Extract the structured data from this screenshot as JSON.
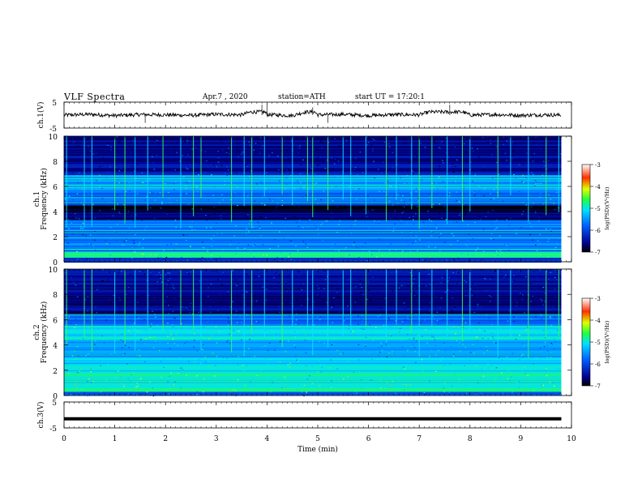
{
  "header": {
    "title": "VLF Spectra",
    "date": "Apr.7 , 2020",
    "station": "station=ATH",
    "start": "start UT = 17:20:1"
  },
  "chart_data": [
    {
      "type": "line",
      "panel": "ch1-waveform",
      "ylabel": "ch.1(V)",
      "ylim": [
        -5,
        5
      ],
      "yticks": [
        "5",
        "-5"
      ],
      "xlim": [
        0,
        10
      ],
      "series": [
        {
          "color": "#000000",
          "x": [
            0,
            0.5,
            1,
            1.5,
            2,
            2.5,
            3,
            3.5,
            3.9,
            4,
            4.5,
            4.9,
            5,
            5.5,
            6,
            6.5,
            7,
            7.6,
            8,
            8.5,
            9,
            9.5,
            9.8
          ],
          "values": [
            0,
            0.3,
            -0.2,
            0.2,
            0.1,
            -0.1,
            0.3,
            0.1,
            2.5,
            0.2,
            -0.2,
            2.0,
            0.1,
            0.3,
            -0.2,
            0.2,
            0.1,
            3.5,
            0,
            0.2,
            -0.1,
            0.1,
            0
          ]
        }
      ],
      "spikes": [
        {
          "x": 1.6,
          "values": [
            -3
          ]
        },
        {
          "x": 3.9,
          "values": [
            4
          ]
        },
        {
          "x": 4.0,
          "values": [
            4
          ]
        },
        {
          "x": 4.9,
          "values": [
            3
          ]
        },
        {
          "x": 5.2,
          "values": [
            -3
          ]
        },
        {
          "x": 7.6,
          "values": [
            4
          ]
        }
      ]
    },
    {
      "type": "heatmap",
      "panel": "ch1-spectrogram",
      "ylabel": [
        "ch.1",
        "Frequency (kHz)"
      ],
      "ylim": [
        0,
        10
      ],
      "yticks": [
        "0",
        "2",
        "4",
        "6",
        "8",
        "10"
      ],
      "xlim": [
        0,
        9.8
      ],
      "colorbar": {
        "label": "log(PSD)(V²/Hz)",
        "range": [
          -7,
          -3
        ],
        "ticks": [
          "-3",
          "-4",
          "-5",
          "-6",
          "-7"
        ],
        "colormap": "jet"
      },
      "frequency_bands": [
        {
          "f": [
            0.0,
            0.4
          ],
          "level": -6.3
        },
        {
          "f": [
            0.4,
            0.9
          ],
          "level": -4.8
        },
        {
          "f": [
            0.9,
            1.5
          ],
          "level": -5.6
        },
        {
          "f": [
            1.5,
            2.6
          ],
          "level": -5.9
        },
        {
          "f": [
            2.6,
            3.4
          ],
          "level": -5.6
        },
        {
          "f": [
            3.4,
            4.0
          ],
          "level": -6.6
        },
        {
          "f": [
            4.0,
            4.5
          ],
          "level": -6.8
        },
        {
          "f": [
            4.5,
            5.5
          ],
          "level": -5.8
        },
        {
          "f": [
            5.5,
            7.0
          ],
          "level": -5.5
        },
        {
          "f": [
            7.0,
            8.5
          ],
          "level": -6.5
        },
        {
          "f": [
            8.5,
            10.0
          ],
          "level": -6.6
        }
      ],
      "tones_khz": [
        0.45,
        0.7,
        1.0,
        1.9,
        2.3,
        2.5,
        4.7,
        5.1,
        5.9,
        6.1,
        6.6,
        6.8
      ],
      "sferics_min": [
        0.05,
        0.4,
        0.55,
        1.0,
        1.2,
        1.4,
        1.65,
        1.95,
        2.3,
        2.55,
        2.7,
        3.3,
        3.55,
        3.7,
        3.95,
        4.3,
        4.5,
        4.8,
        4.9,
        5.2,
        5.5,
        5.65,
        5.95,
        6.35,
        6.55,
        6.85,
        7.0,
        7.25,
        7.55,
        7.85,
        8.0,
        8.55,
        8.8,
        9.15,
        9.5,
        9.75
      ]
    },
    {
      "type": "heatmap",
      "panel": "ch2-spectrogram",
      "ylabel": [
        "ch.2",
        "Frequency (kHz)"
      ],
      "ylim": [
        0,
        10
      ],
      "yticks": [
        "0",
        "2",
        "4",
        "6",
        "8",
        "10"
      ],
      "xlim": [
        0,
        9.8
      ],
      "colorbar": {
        "label": "log(PSD)(V²/Hz)",
        "range": [
          -7,
          -3
        ],
        "ticks": [
          "-3",
          "-4",
          "-5",
          "-6",
          "-7"
        ],
        "colormap": "jet"
      },
      "frequency_bands": [
        {
          "f": [
            0.0,
            0.3
          ],
          "level": -5.8
        },
        {
          "f": [
            0.3,
            1.0
          ],
          "level": -4.8
        },
        {
          "f": [
            1.0,
            2.0
          ],
          "level": -5.0
        },
        {
          "f": [
            2.0,
            3.0
          ],
          "level": -5.2
        },
        {
          "f": [
            3.0,
            4.5
          ],
          "level": -5.5
        },
        {
          "f": [
            4.5,
            5.5
          ],
          "level": -5.1
        },
        {
          "f": [
            5.5,
            6.5
          ],
          "level": -5.8
        },
        {
          "f": [
            6.5,
            8.5
          ],
          "level": -6.6
        },
        {
          "f": [
            8.5,
            10.0
          ],
          "level": -6.5
        }
      ],
      "tones_khz": [
        0.5,
        0.9,
        1.4,
        1.7,
        2.0,
        2.3,
        3.2,
        5.0,
        5.5,
        6.4
      ],
      "sferics_min": [
        0.05,
        0.4,
        0.55,
        1.0,
        1.2,
        1.4,
        1.65,
        1.95,
        2.3,
        2.55,
        2.7,
        3.3,
        3.55,
        3.7,
        3.95,
        4.3,
        4.5,
        4.8,
        4.9,
        5.2,
        5.5,
        5.65,
        5.95,
        6.35,
        6.55,
        6.85,
        7.0,
        7.25,
        7.55,
        7.85,
        8.0,
        8.55,
        8.8,
        9.15,
        9.5,
        9.75
      ]
    },
    {
      "type": "line",
      "panel": "ch3-waveform",
      "ylabel": "ch.3(V)",
      "ylim": [
        -5,
        5
      ],
      "yticks": [
        "5",
        "-5"
      ],
      "xlim": [
        0,
        10
      ],
      "xlabel": "Time (min)",
      "xticks": [
        "0",
        "1",
        "2",
        "3",
        "4",
        "5",
        "6",
        "7",
        "8",
        "9",
        "10"
      ],
      "series": [
        {
          "color": "#000000",
          "x": [
            0,
            9.8
          ],
          "values": [
            -1.5,
            -1.5
          ]
        }
      ]
    }
  ]
}
